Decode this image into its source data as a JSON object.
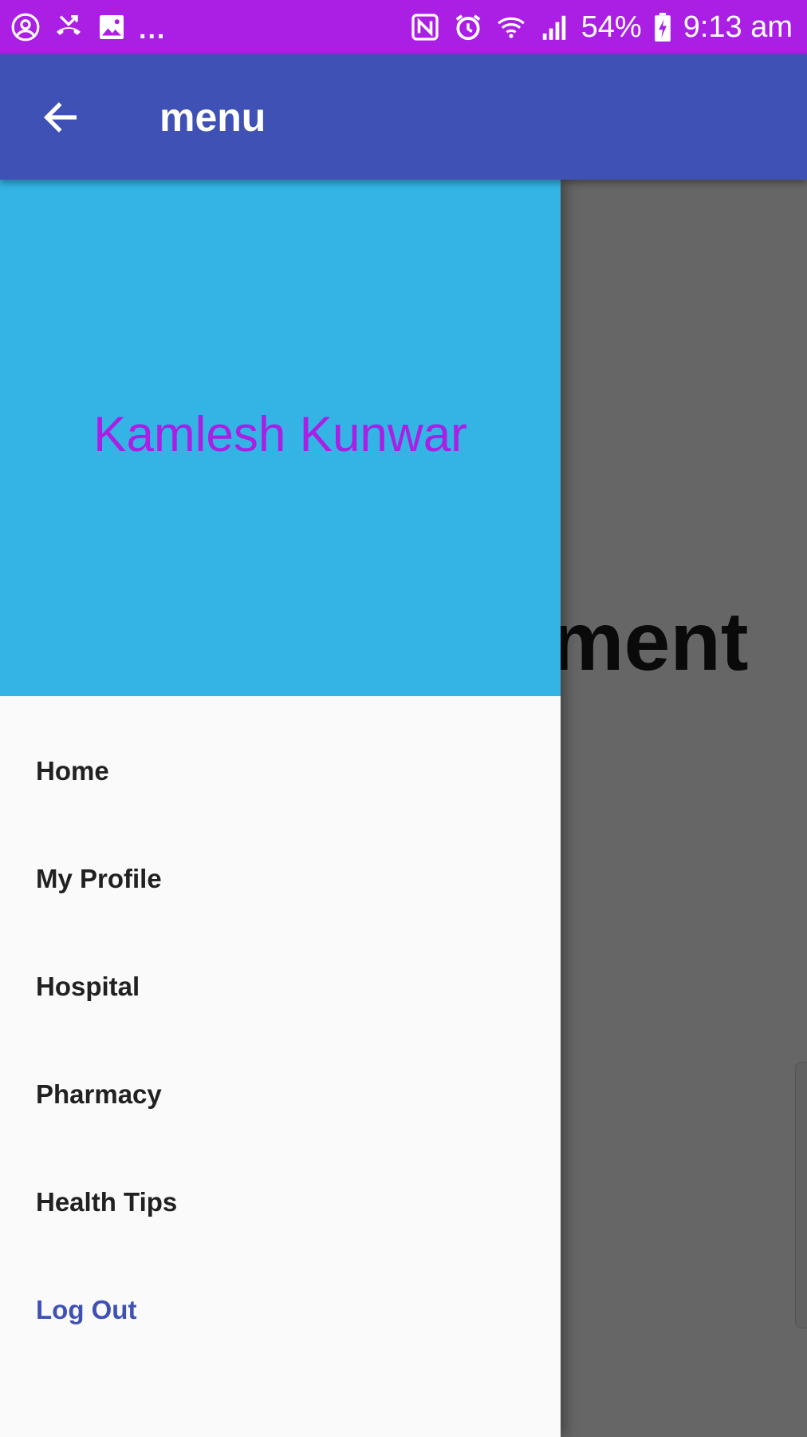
{
  "status_bar": {
    "left_icons": [
      "account-circle-icon",
      "missed-call-icon",
      "image-icon"
    ],
    "more": "...",
    "right_icons": [
      "nfc-icon",
      "alarm-icon",
      "wifi-icon",
      "signal-icon"
    ],
    "battery_percent": "54%",
    "time": "9:13 am",
    "color": "#ab1ee3"
  },
  "app_bar": {
    "title": "menu",
    "back_icon": "arrow-back-icon",
    "color": "#3f51b5"
  },
  "drawer": {
    "header": {
      "user_name": "Kamlesh Kunwar",
      "header_color": "#33b4e5",
      "name_color": "#ab1ee3"
    },
    "items": [
      {
        "label": "Home"
      },
      {
        "label": "My Profile"
      },
      {
        "label": "Hospital"
      },
      {
        "label": "Pharmacy"
      },
      {
        "label": "Health Tips"
      },
      {
        "label": "Log Out"
      }
    ],
    "active_item_color": "#3f51b5"
  },
  "background": {
    "heading_fragment": "ment"
  }
}
